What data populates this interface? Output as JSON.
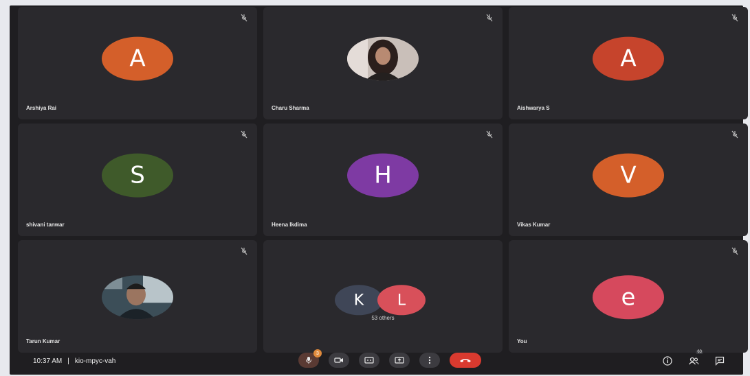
{
  "participants": [
    {
      "name": "Arshiya Rai",
      "initial": "A",
      "color": "#d45f2a",
      "photo": false
    },
    {
      "name": "Charu Sharma",
      "initial": "",
      "color": "#b2a8a4",
      "photo": true
    },
    {
      "name": "Aishwarya S",
      "initial": "A",
      "color": "#c6442c",
      "photo": false
    },
    {
      "name": "shivani tanwar",
      "initial": "S",
      "color": "#3f5a2a",
      "photo": false
    },
    {
      "name": "Heena Ikdima",
      "initial": "H",
      "color": "#7e3aa3",
      "photo": false
    },
    {
      "name": "Vikas Kumar",
      "initial": "V",
      "color": "#d45f2a",
      "photo": false
    },
    {
      "name": "Tarun Kumar",
      "initial": "",
      "color": "#54646d",
      "photo": true
    },
    {
      "name": "You",
      "initial": "e",
      "color": "#d6495d",
      "photo": false
    }
  ],
  "others_tile": {
    "k_initial": "K",
    "k_color": "#3f4657",
    "l_initial": "L",
    "l_color": "#d8505a",
    "label": "53 others"
  },
  "bottom_bar": {
    "time": "10:37 AM",
    "separator": "|",
    "meeting_code": "kio-mpyc-vah",
    "mic_badge": "3",
    "people_count": "63"
  },
  "icons": {
    "mute": "mic-off-icon",
    "mic": "mic-icon",
    "camera": "camera-icon",
    "captions": "captions-icon",
    "present": "present-icon",
    "more": "more-vert-icon",
    "end": "end-call-icon",
    "info": "info-icon",
    "people": "people-icon",
    "chat": "chat-icon"
  }
}
